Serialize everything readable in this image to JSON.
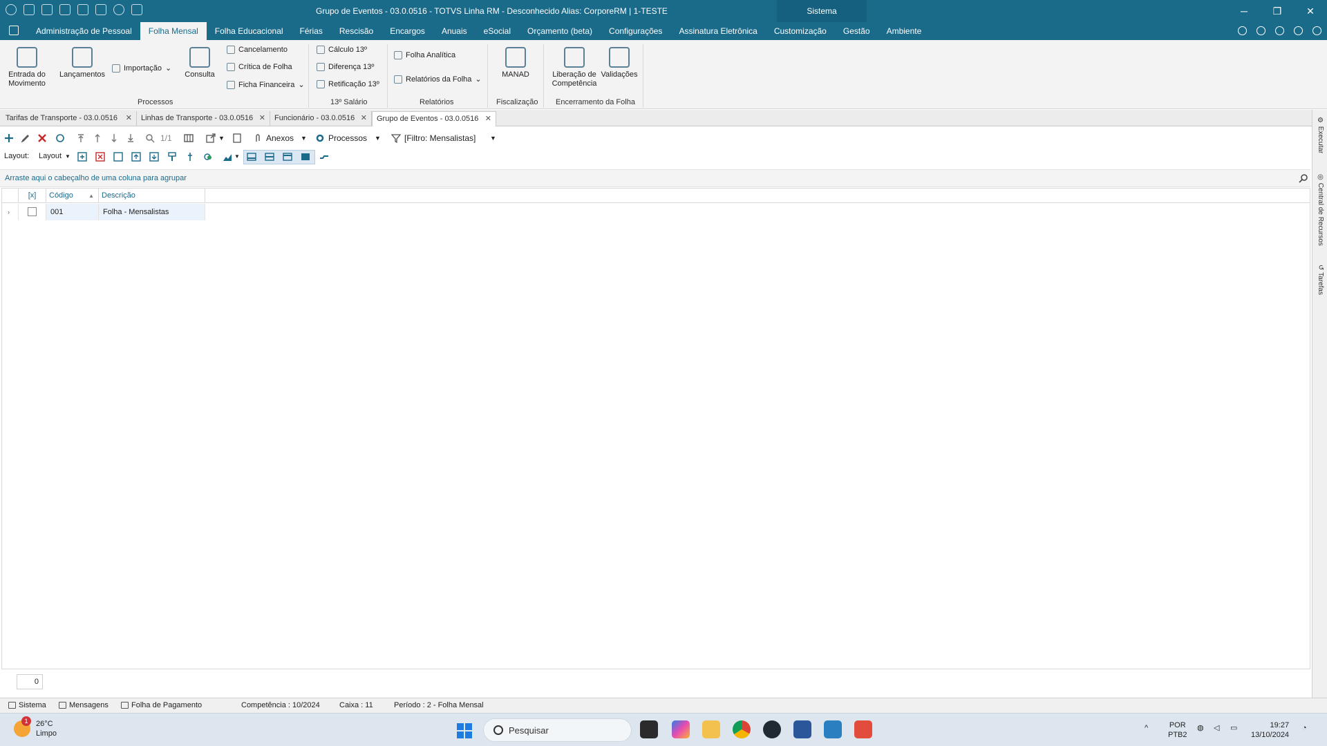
{
  "window": {
    "title": "Grupo de Eventos - 03.0.0516 - TOTVS Linha RM - Desconhecido  Alias: CorporeRM | 1-TESTE",
    "sistema_label": "Sistema",
    "controls": [
      "─",
      "❐",
      "✕"
    ]
  },
  "menu": {
    "tabs": [
      "Administração de Pessoal",
      "Folha Mensal",
      "Folha Educacional",
      "Férias",
      "Rescisão",
      "Encargos",
      "Anuais",
      "eSocial",
      "Orçamento (beta)",
      "Configurações",
      "Assinatura Eletrônica",
      "Customização",
      "Gestão",
      "Ambiente"
    ],
    "active": "Folha Mensal"
  },
  "ribbon": {
    "entrada": "Entrada do Movimento",
    "lancamentos": "Lançamentos",
    "importacao": "Importação",
    "consulta": "Consulta",
    "cancelamento": "Cancelamento",
    "critica": "Crítica de Folha",
    "ficha": "Ficha Financeira",
    "calculo13": "Cálculo 13º",
    "diferenca13": "Diferença 13º",
    "retificacao13": "Retificação 13º",
    "folha_analitica": "Folha Analítica",
    "relatorios_folha": "Relatórios da Folha",
    "manad": "MANAD",
    "liberacao": "Liberação de Competência",
    "validacoes": "Validações",
    "groups": {
      "processos": "Processos",
      "salario13": "13º Salário",
      "relatorios": "Relatórios",
      "fiscalizacao": "Fiscalização",
      "encerramento": "Encerramento da Folha"
    }
  },
  "doc_tabs": [
    "Tarifas de Transporte - 03.0.0516",
    "Linhas de Transporte - 03.0.0516",
    "Funcionário - 03.0.0516",
    "Grupo de Eventos - 03.0.0516"
  ],
  "toolbar": {
    "page_indicator": "1/1",
    "anexos": "Anexos",
    "processos": "Processos",
    "filtro": "[Filtro: Mensalistas]",
    "layout_label": "Layout:",
    "layout_dropdown": "Layout"
  },
  "grid": {
    "group_hint": "Arraste aqui o cabeçalho de uma coluna para agrupar",
    "columns": [
      "[x]",
      "Código",
      "Descrição"
    ],
    "rows": [
      {
        "codigo": "001",
        "descricao": "Folha - Mensalistas"
      }
    ],
    "record_count": "0"
  },
  "side_panel": [
    "Executar",
    "Central de Recursos",
    "Tarefas"
  ],
  "status_bar": {
    "sistema": "Sistema",
    "mensagens": "Mensagens",
    "folha": "Folha de Pagamento",
    "competencia": "Competência : 10/2024",
    "caixa": "Caixa : 11",
    "periodo": "Período : 2 - Folha Mensal"
  },
  "taskbar": {
    "weather_temp": "26°C",
    "weather_desc": "Limpo",
    "weather_badge": "1",
    "search_placeholder": "Pesquisar",
    "lang_top": "POR",
    "lang_bottom": "PTB2",
    "time": "19:27",
    "date": "13/10/2024"
  },
  "colors": {
    "titlebar": "#1a6a8a",
    "ribbon_bg": "#f3f3f3",
    "accent_text": "#1a6a8a"
  }
}
